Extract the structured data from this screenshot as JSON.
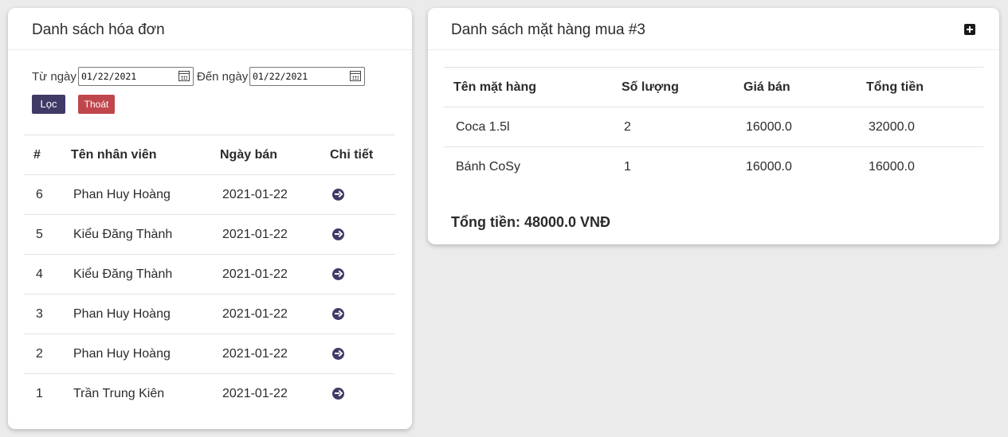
{
  "invoice_panel": {
    "title": "Danh sách hóa đơn",
    "from_label": "Từ ngày",
    "from_value": "01/22/2021",
    "to_label": "Đến ngày",
    "to_value": "01/22/2021",
    "filter_button": "Lọc",
    "exit_button": "Thoát",
    "columns": [
      "#",
      "Tên nhân viên",
      "Ngày bán",
      "Chi tiết"
    ],
    "rows": [
      {
        "id": "6",
        "employee": "Phan Huy Hoàng",
        "date": "2021-01-22",
        "icon": "arrow-right-circle-icon"
      },
      {
        "id": "5",
        "employee": "Kiểu Đăng Thành",
        "date": "2021-01-22",
        "icon": "arrow-right-circle-icon"
      },
      {
        "id": "4",
        "employee": "Kiểu Đăng Thành",
        "date": "2021-01-22",
        "icon": "arrow-right-circle-icon"
      },
      {
        "id": "3",
        "employee": "Phan Huy Hoàng",
        "date": "2021-01-22",
        "icon": "arrow-right-circle-icon"
      },
      {
        "id": "2",
        "employee": "Phan Huy Hoàng",
        "date": "2021-01-22",
        "icon": "arrow-right-circle-icon"
      },
      {
        "id": "1",
        "employee": "Trần Trung Kiên",
        "date": "2021-01-22",
        "icon": "arrow-right-circle-icon"
      }
    ]
  },
  "items_panel": {
    "title": "Danh sách mặt hàng mua #3",
    "add_icon": "plus-square-icon",
    "columns": [
      "Tên mặt hàng",
      "Số lượng",
      "Giá bán",
      "Tổng tiền"
    ],
    "rows": [
      {
        "name": "Coca 1.5l",
        "quantity": "2",
        "price": "16000.0",
        "total": "32000.0"
      },
      {
        "name": "Bánh CoSy",
        "quantity": "1",
        "price": "16000.0",
        "total": "16000.0"
      }
    ],
    "grand_total": "Tổng tiền: 48000.0 VNĐ"
  },
  "colors": {
    "primary": "#3f3b66",
    "danger": "#c0464d",
    "background": "#ebebeb"
  }
}
